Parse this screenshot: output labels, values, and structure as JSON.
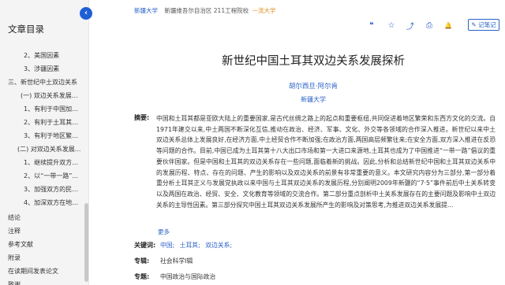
{
  "sidebar": {
    "title": "文章目录",
    "collapse_glyph": "‹",
    "toc": [
      {
        "label": "2、美国因素",
        "level": "l3"
      },
      {
        "label": "3、涉疆因素",
        "level": "l3"
      },
      {
        "label": "三、新世纪中土双边关系",
        "level": "l1"
      },
      {
        "label": "(一) 双边关系发展的...",
        "level": "l2"
      },
      {
        "label": "1、有利于中国加快...",
        "level": "l3"
      },
      {
        "label": "2、有利于土耳其国...",
        "level": "l3"
      },
      {
        "label": "3、有利于地区繁荣...",
        "level": "l3"
      },
      {
        "label": "(二) 对双边关系发展...",
        "level": "l2b"
      },
      {
        "label": "1、继续提升双方的...",
        "level": "l3"
      },
      {
        "label": "2、以“一带一路”...",
        "level": "l3"
      },
      {
        "label": "3、加强双方的民间...",
        "level": "l3"
      },
      {
        "label": "4、加深双方在地区...",
        "level": "l3"
      },
      {
        "label": "结论",
        "level": "l1",
        "gap": true
      },
      {
        "label": "注释",
        "level": "l1"
      },
      {
        "label": "参考文献",
        "level": "l1"
      },
      {
        "label": "附录",
        "level": "l1"
      },
      {
        "label": "在读期间发表论文",
        "level": "l1"
      },
      {
        "label": "致谢",
        "level": "l1"
      }
    ]
  },
  "breadcrumb": {
    "link": "新疆大学",
    "text": "新疆维吾尔自治区 211工程院校",
    "tag": "一流大学"
  },
  "toolbar": {
    "icons": [
      "quote-icon",
      "star-icon",
      "share-icon",
      "print-icon",
      "bell-icon"
    ],
    "glyphs": [
      "❝",
      "☆",
      "⤴",
      "⎙",
      "🔔"
    ],
    "note_label": "记笔记",
    "note_glyph": "✎"
  },
  "article": {
    "title": "新世纪中国土耳其双边关系发展探析",
    "author": "胡尔西旦·阿尔肯",
    "org": "新疆大学",
    "abstract_label": "摘要:",
    "abstract": "中国和土耳其都是亚欧大陆上的重要国家,是古代丝绸之路上的起点和重要枢纽,共同促进着地区繁荣和东西方文化的交流。自1971年建交以来,中土两国不断深化互信,推动在政治、经济、军事、文化、外交等各领域的合作深入推进。新世纪以来中土双边关系总体上发展良好,在经济方面,中土经贸合作不断加强;在政治方面,两国高层频繁往来;在安全方面,双方深入推进在反恐等问题的合作。目前,中国已成为土耳其第十八大出口市场和第一大进口来源地,土耳其也成为了中国推进“一带一路”倡议的重要伙伴国家。但是中国和土耳其的双边关系存在一些问题,面临着新的挑战。因此,分析和总结新世纪中国和土耳其双边关系中的发展历程、特点、存在的问题、产生的影响以及双边关系的前景有非常重要的意义。本文研究内容分为三部分,第一部分着重分析土耳其正义与发展党执政以来中国与土耳其双边关系的发展历程,分别阐明2009年新疆的“7·5”事件前后中土关系转变以及两国在政治、经贸、安全、文化教育等领域的交流合作。第二部分重点剖析中土关系发展存在的主要问题及影响中土双边关系的主导性因素。第三部分探究中国土耳其双边关系发展所产生的影响及对策思考,为推进双边关系发展提...",
    "more": "更多",
    "keywords_label": "关键词:",
    "keywords": [
      "中国;",
      "土耳其;",
      "双边关系;"
    ],
    "subject_label": "专辑:",
    "subject": "社会科学Ⅰ辑",
    "topic_label": "专题:",
    "topic": "中国政治与国际政治"
  }
}
